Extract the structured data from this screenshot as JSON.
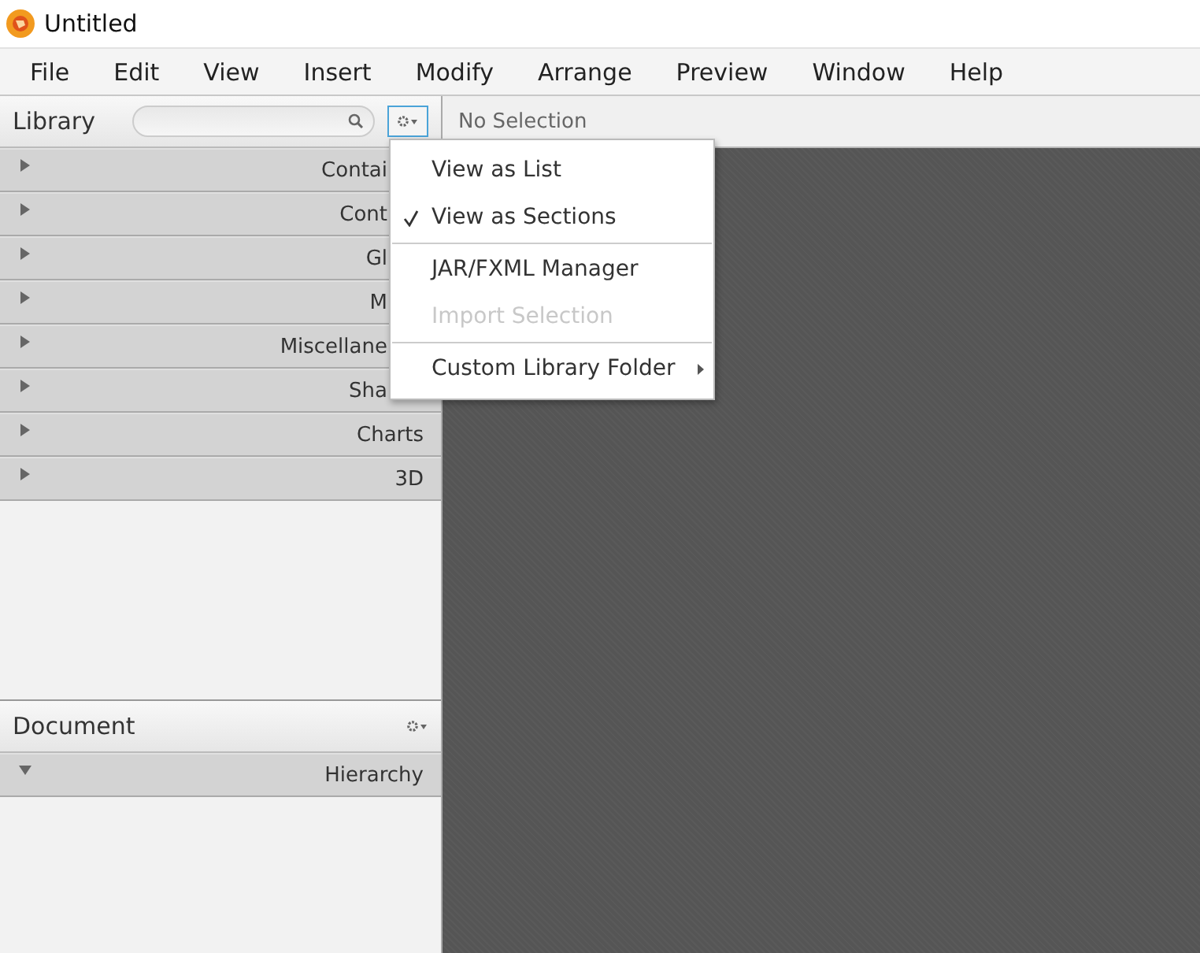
{
  "window": {
    "title": "Untitled"
  },
  "menu_bar": [
    "File",
    "Edit",
    "View",
    "Insert",
    "Modify",
    "Arrange",
    "Preview",
    "Window",
    "Help"
  ],
  "library": {
    "title": "Library",
    "sections": [
      {
        "label": "Contai",
        "expanded": false,
        "covered": true
      },
      {
        "label": "Cont",
        "expanded": false,
        "covered": true
      },
      {
        "label": "Gl",
        "expanded": false,
        "covered": true
      },
      {
        "label": "M",
        "expanded": false,
        "covered": true
      },
      {
        "label": "Miscellane",
        "expanded": false,
        "covered": true
      },
      {
        "label": "Sha",
        "expanded": false,
        "covered": true
      },
      {
        "label": "Charts",
        "expanded": false
      },
      {
        "label": "3D",
        "expanded": false
      }
    ]
  },
  "document": {
    "title": "Document",
    "sections": [
      {
        "label": "Hierarchy",
        "expanded": true
      }
    ]
  },
  "content_toolbar": {
    "selection": "No Selection"
  },
  "popup_menu": [
    {
      "kind": "item",
      "label": "View as List",
      "checked": false,
      "disabled": false
    },
    {
      "kind": "item",
      "label": "View as Sections",
      "checked": true,
      "disabled": false
    },
    {
      "kind": "separator"
    },
    {
      "kind": "item",
      "label": "JAR/FXML Manager",
      "checked": false,
      "disabled": false
    },
    {
      "kind": "item",
      "label": "Import Selection",
      "checked": false,
      "disabled": true
    },
    {
      "kind": "separator"
    },
    {
      "kind": "submenu",
      "label": "Custom Library Folder",
      "checked": false,
      "disabled": false
    }
  ]
}
